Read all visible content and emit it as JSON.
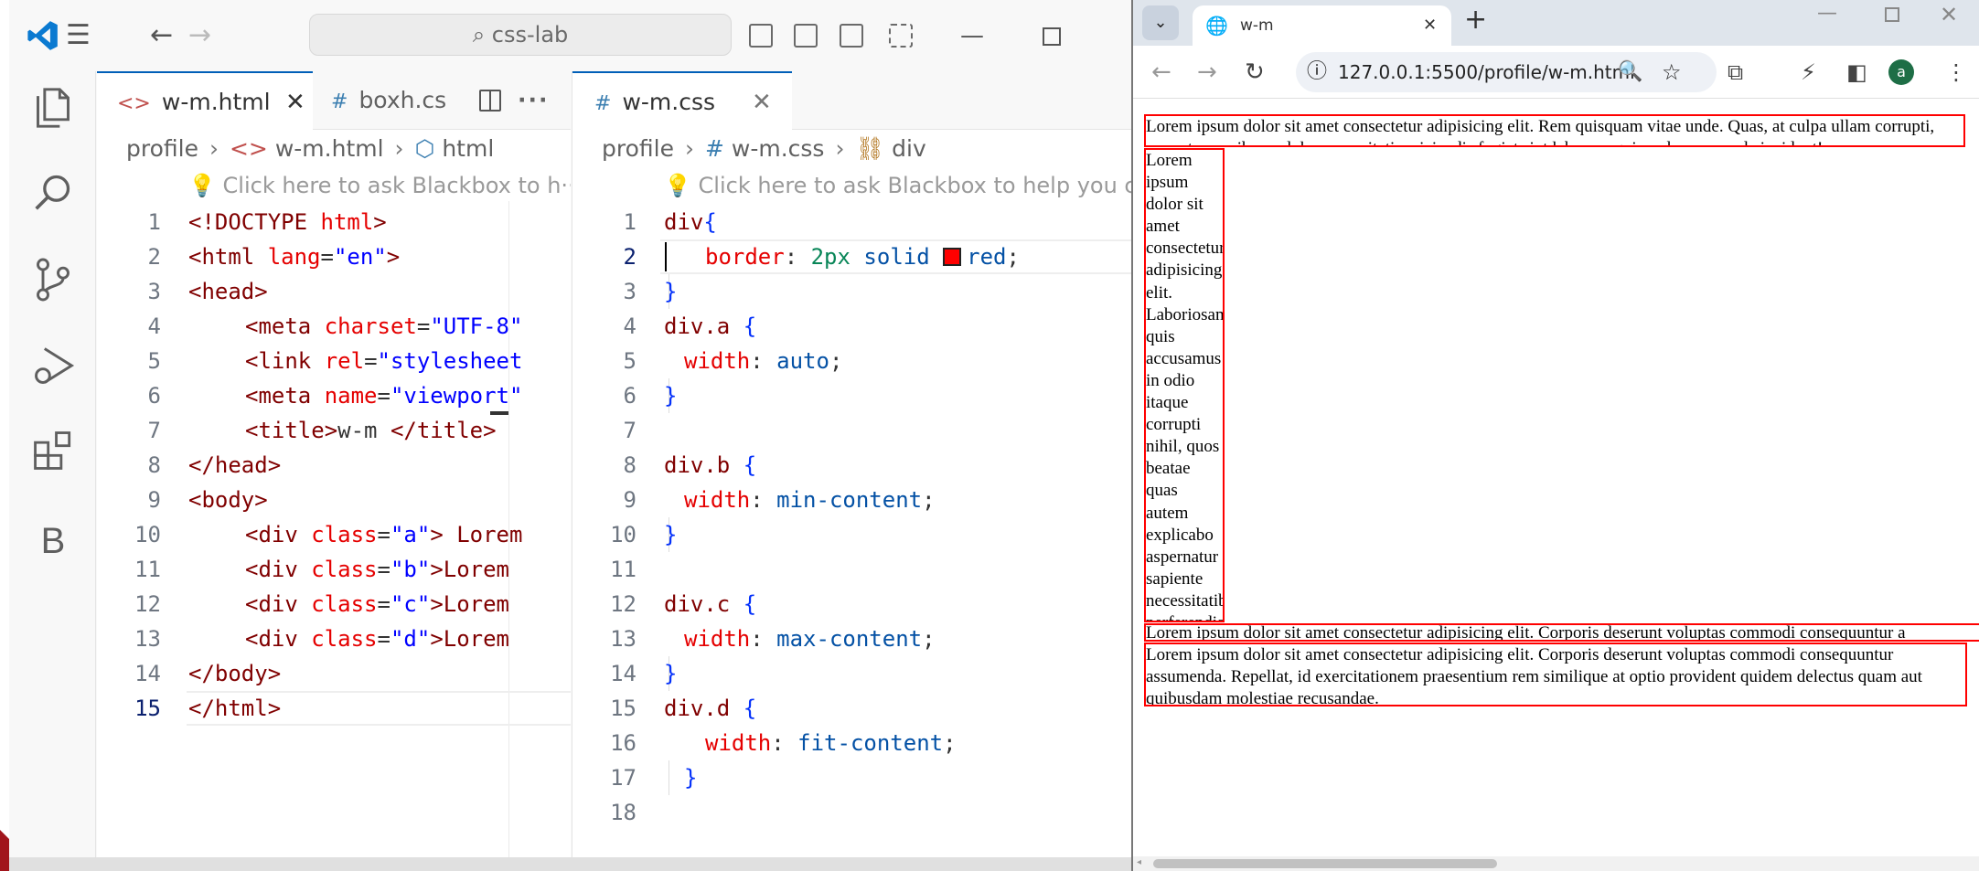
{
  "vscode": {
    "search_text": "css-lab",
    "activity": [
      "explorer-icon",
      "search-icon",
      "source-control-icon",
      "run-debug-icon",
      "extensions-icon",
      "blackbox-icon"
    ],
    "blackbox_letter": "B",
    "left": {
      "tabs": [
        {
          "label": "w-m.html",
          "icon": "<>"
        },
        {
          "label": "boxh.cs",
          "icon": "#"
        }
      ],
      "crumbs": [
        "profile",
        "w-m.html",
        "html"
      ],
      "hint": "Click here to ask Blackbox to h···",
      "line_numbers": [
        "1",
        "2",
        "3",
        "4",
        "5",
        "6",
        "7",
        "8",
        "9",
        "10",
        "11",
        "12",
        "13",
        "14",
        "15"
      ]
    },
    "right": {
      "tabs": [
        {
          "label": "w-m.css",
          "icon": "#"
        }
      ],
      "crumbs": [
        "profile",
        "w-m.css",
        "div"
      ],
      "hint": "Click here to ask Blackbox to help you cod",
      "line_numbers": [
        "1",
        "2",
        "3",
        "4",
        "5",
        "6",
        "7",
        "8",
        "9",
        "10",
        "11",
        "12",
        "13",
        "14",
        "15",
        "16",
        "17",
        "18"
      ]
    },
    "html_code": {
      "l1a": "<!DOCTYPE ",
      "l1b": "html",
      "l1c": ">",
      "l2a": "<html ",
      "l2b": "lang",
      "l2c": "=",
      "l2d": "\"en\"",
      "l2e": ">",
      "l3": "<head>",
      "l4a": "<meta ",
      "l4b": "charset",
      "l4c": "=",
      "l4d": "\"UTF-8\"",
      "l5a": "<link ",
      "l5b": "rel",
      "l5c": "=",
      "l5d": "\"stylesheet",
      "l6a": "<meta ",
      "l6b": "name",
      "l6c": "=",
      "l6d": "\"viewport\"",
      "l7a": "<title>",
      "l7b": "w-m ",
      "l7c": "</title>",
      "l8": "</head>",
      "l9": "<body>",
      "l10a": "<div ",
      "l10b": "class",
      "l10c": "=",
      "l10d": "\"a\"",
      "l10e": "> Lorem",
      "l11a": "<div ",
      "l11b": "class",
      "l11c": "=",
      "l11d": "\"b\"",
      "l11e": ">Lorem",
      "l12a": "<div ",
      "l12b": "class",
      "l12c": "=",
      "l12d": "\"c\"",
      "l12e": ">Lorem",
      "l13a": "<div ",
      "l13b": "class",
      "l13c": "=",
      "l13d": "\"d\"",
      "l13e": ">Lorem",
      "l14": "</body>",
      "l15": "</html>"
    },
    "css_code": {
      "l1a": "div",
      "l1b": "{",
      "l2a": "border",
      "l2b": ": ",
      "l2c": "2px",
      "l2d": " solid ",
      "l2e": "red",
      "l2f": ";",
      "l3": "}",
      "l4a": "div.a ",
      "l4b": "{",
      "l5a": "width",
      "l5b": ": ",
      "l5c": "auto",
      "l5d": ";",
      "l6": "}",
      "l8a": "div.b ",
      "l8b": "{",
      "l9a": "width",
      "l9b": ": ",
      "l9c": "min-content",
      "l9d": ";",
      "l10": "}",
      "l12a": "div.c ",
      "l12b": "{",
      "l13a": "width",
      "l13b": ": ",
      "l13c": "max-content",
      "l13d": ";",
      "l14": "}",
      "l15a": "div.d ",
      "l15b": "{",
      "l16a": "width",
      "l16b": ": ",
      "l16c": "fit-content",
      "l16d": ";",
      "l17": "}"
    }
  },
  "browser": {
    "tab_title": "w-m",
    "url": "127.0.0.1:5500/profile/w-m.html",
    "avatar_letter": "a",
    "divs": {
      "a": "Lorem ipsum dolor sit amet consectetur adipisicing elit. Rem quisquam vitae unde. Quas, at culpa ullam corrupti, porro temporibus a dolorum veritatis reiciendis fugiat sint laborum quis sed, assumenda incidunt!",
      "b": "Lorem ipsum dolor sit amet consectetur adipisicing elit. Laboriosam quis accusamus in odio itaque corrupti nihil, quos beatae quas autem explicabo aspernatur sapiente necessitatibus perferendis veritatis, blanditiis reprehenderit rem iure?",
      "c": "Lorem ipsum dolor sit amet consectetur adipisicing elit. Corporis deserunt voluptas commodi consequuntur a",
      "d": "Lorem ipsum dolor sit amet consectetur adipisicing elit. Corporis deserunt voluptas commodi consequuntur assumenda. Repellat, id exercitationem praesentium rem similique at optio provident quidem delectus quam aut quibusdam molestiae recusandae."
    }
  }
}
